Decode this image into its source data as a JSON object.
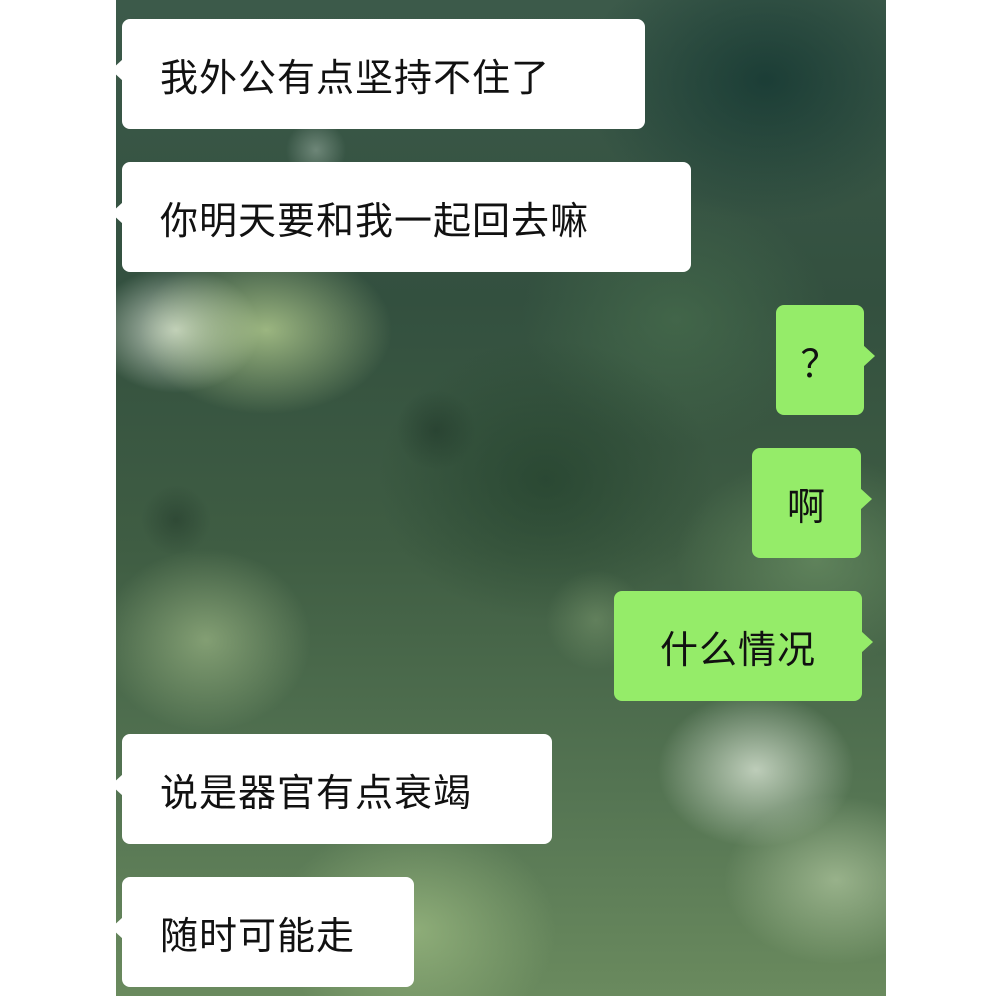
{
  "chat": {
    "background_image": "blurred-green-foliage",
    "colors": {
      "incoming_bubble": "#ffffff",
      "outgoing_bubble": "#95ec69",
      "text": "#111111"
    },
    "messages": [
      {
        "side": "incoming",
        "text": "我外公有点坚持不住了"
      },
      {
        "side": "incoming",
        "text": "你明天要和我一起回去嘛"
      },
      {
        "side": "outgoing",
        "text": "？"
      },
      {
        "side": "outgoing",
        "text": "啊"
      },
      {
        "side": "outgoing",
        "text": "什么情况"
      },
      {
        "side": "incoming",
        "text": "说是器官有点衰竭"
      },
      {
        "side": "incoming",
        "text": "随时可能走"
      }
    ]
  }
}
